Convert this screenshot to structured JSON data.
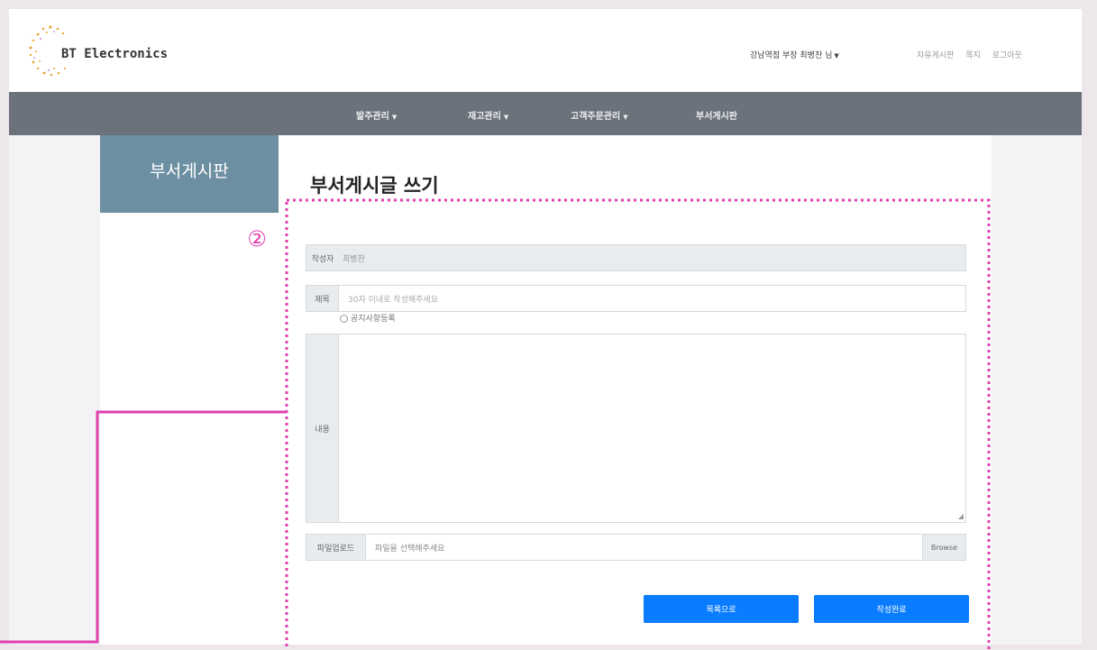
{
  "brand": {
    "name": "BT Electronics"
  },
  "header": {
    "user_menu": "강남역점 부장 최병찬 님",
    "util_links": [
      "자유게시판",
      "쪽지",
      "로그아웃"
    ]
  },
  "nav": {
    "items": [
      {
        "label": "발주관리",
        "dropdown": true
      },
      {
        "label": "재고관리",
        "dropdown": true
      },
      {
        "label": "고객주문관리",
        "dropdown": true
      },
      {
        "label": "부서게시판",
        "dropdown": false
      }
    ]
  },
  "sidebar": {
    "title": "부서게시판"
  },
  "main": {
    "title": "부서게시글 쓰기",
    "form": {
      "author_label": "작성자",
      "author_value": "최병찬",
      "subject_label": "제목",
      "subject_placeholder": "30자 이내로 작성해주세요",
      "notice_label": "공지사항등록",
      "content_label": "내용",
      "upload_label": "파일업로드",
      "upload_placeholder": "파일을 선택해주세요",
      "browse_label": "Browse"
    },
    "buttons": {
      "list": "목록으로",
      "submit": "작성완료"
    }
  },
  "annotation": {
    "marker": "②",
    "color": "#e040b0"
  }
}
